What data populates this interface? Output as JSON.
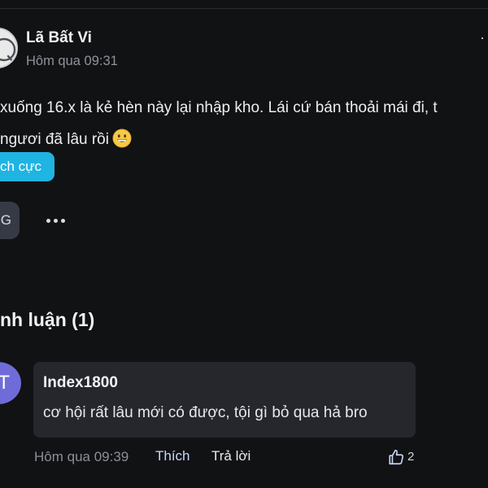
{
  "post": {
    "author": "Lã Bất Vi",
    "time": "Hôm qua 09:31",
    "body_line1": "xuống 16.x là kẻ hèn này lại nhập kho. Lái cứ bán thoải mái đi, t",
    "body_line2": "ngươi đã lâu rồi",
    "emoji": "grinning-face",
    "tag": "ch cực",
    "reaction_label": "G"
  },
  "comments": {
    "title": "nh luận (1)",
    "items": [
      {
        "avatar_letter": "T",
        "avatar_color": "#6f6cd9",
        "name": "Index1800",
        "text": "cơ hội rất lâu mới có được, tội gì bỏ qua hả bro",
        "time": "Hôm qua 09:39",
        "like_label": "Thích",
        "reply_label": "Trả lời",
        "like_count": "2"
      }
    ]
  },
  "colors": {
    "background": "#111214",
    "tag_chip": "#1fb4e2",
    "bubble": "#25272d",
    "like_link": "#c9d7ff"
  },
  "icons": {
    "overflow_menu": "more-horizontal-icon",
    "thumbs_up": "thumbs-up-icon",
    "emoji": "grinning-face-emoji"
  }
}
